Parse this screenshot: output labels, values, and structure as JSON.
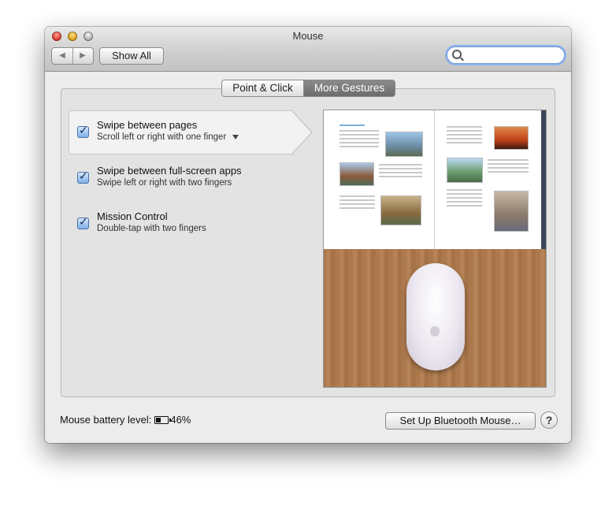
{
  "window": {
    "title": "Mouse"
  },
  "toolbar": {
    "back_icon": "back-arrow-icon",
    "forward_icon": "forward-arrow-icon",
    "show_all_label": "Show All",
    "search_placeholder": ""
  },
  "tabs": [
    {
      "label": "Point & Click",
      "selected": false
    },
    {
      "label": "More Gestures",
      "selected": true
    }
  ],
  "gestures": [
    {
      "title": "Swipe between pages",
      "subtitle": "Scroll left or right with one finger",
      "checked": true,
      "selected": true,
      "has_dropdown": true
    },
    {
      "title": "Swipe between full-screen apps",
      "subtitle": "Swipe left or right with two fingers",
      "checked": true,
      "selected": false
    },
    {
      "title": "Mission Control",
      "subtitle": "Double-tap with two fingers",
      "checked": true,
      "selected": false
    }
  ],
  "footer": {
    "battery_label": "Mouse battery level:",
    "battery_value": "46%",
    "battery_fraction": 0.46,
    "bluetooth_button": "Set Up Bluetooth Mouse…",
    "help_label": "?"
  },
  "colors": {
    "accent": "#7fb0ea",
    "selected_tab": "#777777",
    "wood": "#a87548"
  }
}
